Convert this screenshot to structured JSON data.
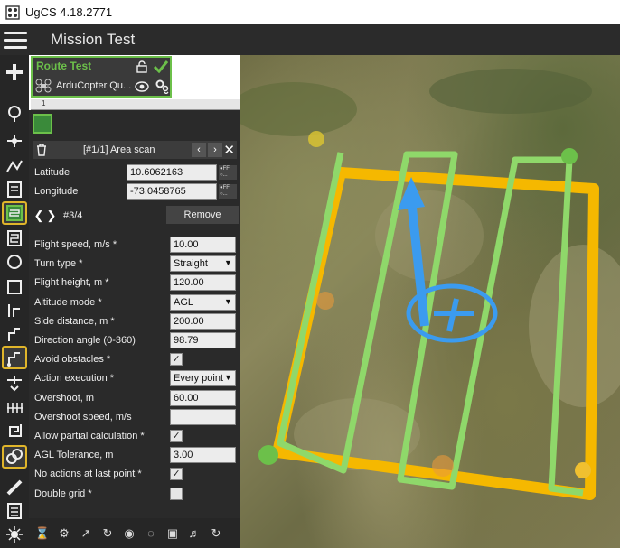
{
  "window": {
    "title": "UgCS 4.18.2771"
  },
  "header": {
    "title": "Mission Test"
  },
  "route": {
    "name": "Route Test",
    "vehicle": "ArduCopter Qu..."
  },
  "ruler": {
    "mark": "1"
  },
  "segment": {
    "label": "[#1/1] Area scan"
  },
  "coords": {
    "latitude_label": "Latitude",
    "latitude_value": "10.6062163",
    "longitude_label": "Longitude",
    "longitude_value": "-73.0458765",
    "tag": "OFF\nO..."
  },
  "point_nav": {
    "index": "#3/4",
    "remove_label": "Remove"
  },
  "params": [
    {
      "label": "Flight speed, m/s *",
      "value": "10.00",
      "kind": "input"
    },
    {
      "label": "Turn type *",
      "value": "Straight",
      "kind": "select"
    },
    {
      "label": "Flight height, m *",
      "value": "120.00",
      "kind": "input"
    },
    {
      "label": "Altitude mode *",
      "value": "AGL",
      "kind": "select"
    },
    {
      "label": "Side distance, m *",
      "value": "200.00",
      "kind": "input"
    },
    {
      "label": "Direction angle (0-360)",
      "value": "98.79",
      "kind": "input"
    },
    {
      "label": "Avoid obstacles *",
      "value": true,
      "kind": "check"
    },
    {
      "label": "Action execution *",
      "value": "Every point",
      "kind": "select"
    },
    {
      "label": "Overshoot, m",
      "value": "60.00",
      "kind": "input"
    },
    {
      "label": "Overshoot speed, m/s",
      "value": "",
      "kind": "input"
    },
    {
      "label": "Allow partial calculation *",
      "value": true,
      "kind": "check"
    },
    {
      "label": "AGL Tolerance, m",
      "value": "3.00",
      "kind": "input"
    },
    {
      "label": "No actions at last point *",
      "value": true,
      "kind": "check"
    },
    {
      "label": "Double grid *",
      "value": false,
      "kind": "check"
    }
  ],
  "colors": {
    "accent_green": "#6cc04a",
    "route_yellow": "#f5b800",
    "path_green": "#8fd86a",
    "selected_tool": "#e0b52a"
  },
  "icons": [
    "hamburger-icon",
    "lock-icon",
    "check-icon",
    "drone-icon",
    "eye-icon",
    "settings-icon",
    "trash-icon",
    "chevron-left-icon",
    "chevron-right-icon",
    "close-icon"
  ]
}
